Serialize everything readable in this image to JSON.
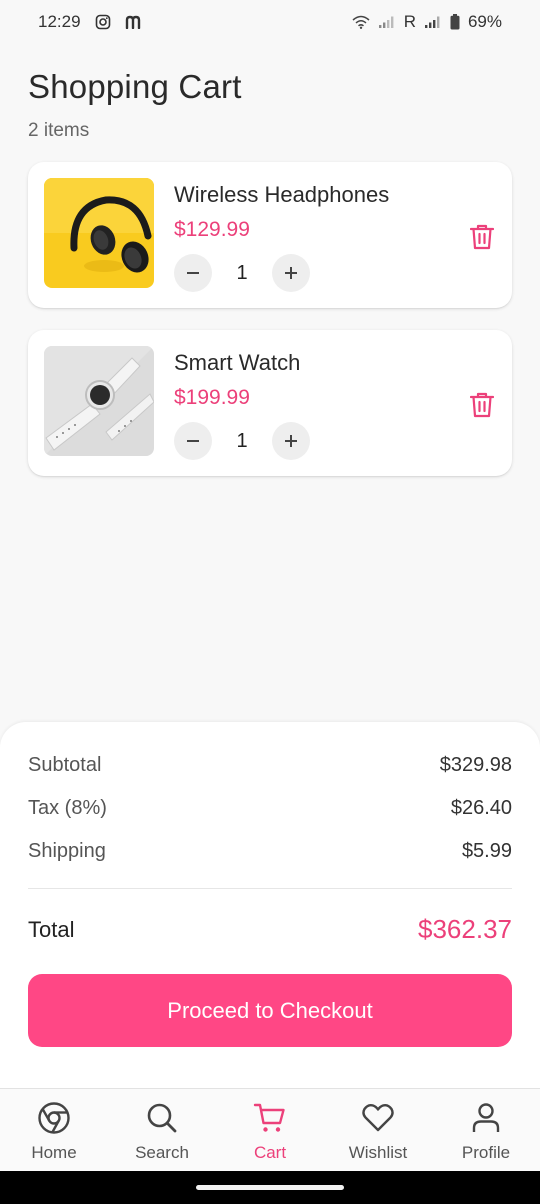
{
  "status_bar": {
    "time": "12:29",
    "carrier_r": "R",
    "battery": "69%"
  },
  "header": {
    "title": "Shopping Cart",
    "item_count": "2 items"
  },
  "cart": {
    "items": [
      {
        "name": "Wireless Headphones",
        "price": "$129.99",
        "quantity": "1",
        "image": "headphones-image"
      },
      {
        "name": "Smart Watch",
        "price": "$199.99",
        "quantity": "1",
        "image": "smartwatch-image"
      }
    ]
  },
  "summary": {
    "subtotal_label": "Subtotal",
    "subtotal_value": "$329.98",
    "tax_label": "Tax (8%)",
    "tax_value": "$26.40",
    "shipping_label": "Shipping",
    "shipping_value": "$5.99",
    "total_label": "Total",
    "total_value": "$362.37",
    "checkout_label": "Proceed to Checkout"
  },
  "nav": {
    "items": [
      {
        "label": "Home",
        "icon": "chrome-icon",
        "active": false
      },
      {
        "label": "Search",
        "icon": "search-icon",
        "active": false
      },
      {
        "label": "Cart",
        "icon": "cart-icon",
        "active": true
      },
      {
        "label": "Wishlist",
        "icon": "heart-icon",
        "active": false
      },
      {
        "label": "Profile",
        "icon": "person-icon",
        "active": false
      }
    ]
  },
  "colors": {
    "accent": "#ec407a",
    "button": "#ff4785",
    "background": "#f8f8f8"
  }
}
